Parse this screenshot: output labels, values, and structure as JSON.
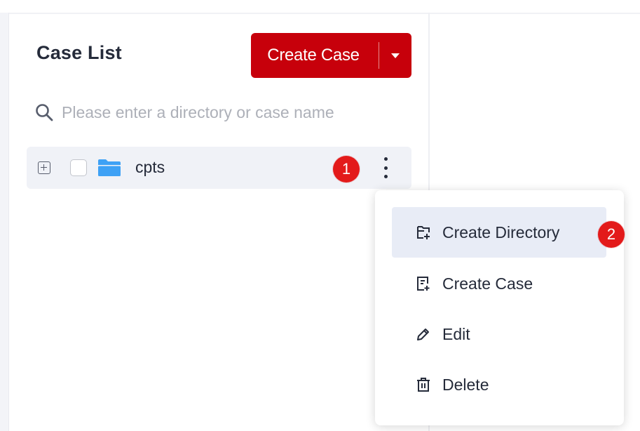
{
  "panel": {
    "title": "Case List",
    "create_button": {
      "label": "Create Case",
      "dropdown_icon": "caret-down-icon"
    }
  },
  "search": {
    "placeholder": "Please enter a directory or case name",
    "value": "",
    "icon": "search-icon"
  },
  "tree": {
    "nodes": [
      {
        "label": "cpts",
        "expanded": false,
        "checked": false,
        "icon": "folder-icon"
      }
    ]
  },
  "annotations": {
    "step1": "1",
    "step2": "2"
  },
  "context_menu": {
    "items": [
      {
        "label": "Create Directory",
        "icon": "create-directory-icon",
        "highlighted": true
      },
      {
        "label": "Create Case",
        "icon": "create-case-icon",
        "highlighted": false
      },
      {
        "label": "Edit",
        "icon": "edit-icon",
        "highlighted": false
      },
      {
        "label": "Delete",
        "icon": "delete-icon",
        "highlighted": false
      }
    ]
  },
  "colors": {
    "brand_red": "#c7000b",
    "badge_red": "#e31a1a",
    "row_highlight": "#f0f2f7",
    "menu_highlight": "#e8ecf6",
    "folder_blue": "#3ea1f5"
  }
}
